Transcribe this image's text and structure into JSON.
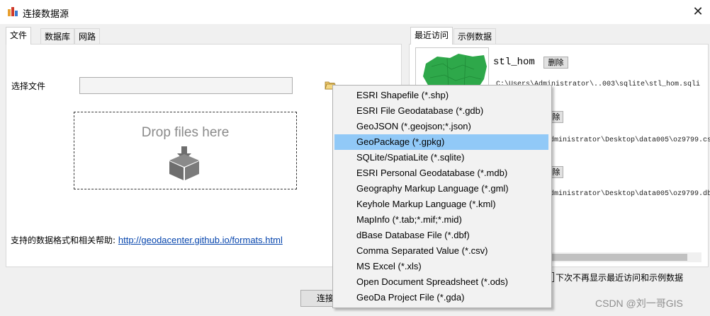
{
  "window": {
    "title": "连接数据源",
    "close_label": "✕"
  },
  "left_tabs": [
    "文件",
    "数据库",
    "网路"
  ],
  "right_tabs": [
    "最近访问",
    "示例数据"
  ],
  "file_tab": {
    "select_label": "选择文件",
    "drop_text": "Drop files here",
    "help_prefix": "支持的数据格式和相关帮助: ",
    "help_link": "http://geodacenter.github.io/formats.html"
  },
  "recent": {
    "items": [
      {
        "name": "stl_hom",
        "path": "C:\\Users\\Administrator\\..003\\sqlite\\stl_hom.sqli",
        "delete_label": "删除"
      },
      {
        "name": "",
        "path": "dministrator\\Desktop\\data005\\oz9799.cs",
        "delete_label": "除"
      },
      {
        "name": "",
        "path": "dministrator\\Desktop\\data005\\oz9799.db",
        "delete_label": "除"
      }
    ]
  },
  "checkbox_label": "下次不再显示最近访问和示例数据",
  "connect_label": "连接",
  "file_types": [
    "ESRI Shapefile (*.shp)",
    "ESRI File Geodatabase (*.gdb)",
    "GeoJSON (*.geojson;*.json)",
    "GeoPackage (*.gpkg)",
    "SQLite/SpatiaLite (*.sqlite)",
    "ESRI Personal Geodatabase (*.mdb)",
    "Geography Markup Language (*.gml)",
    "Keyhole Markup Language (*.kml)",
    "MapInfo (*.tab;*.mif;*.mid)",
    "dBase Database File (*.dbf)",
    "Comma Separated Value (*.csv)",
    "MS Excel (*.xls)",
    "Open Document Spreadsheet (*.ods)",
    "GeoDa Project File (*.gda)"
  ],
  "selected_index": 3,
  "watermark": "CSDN @刘一哥GIS",
  "colors": {
    "selection": "#91c9f7",
    "link": "#0645ad",
    "map_green": "#2ea84a"
  }
}
